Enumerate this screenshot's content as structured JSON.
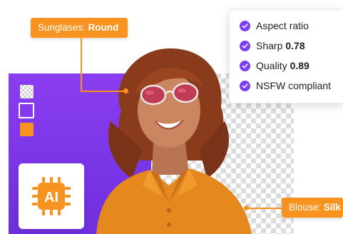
{
  "labels": {
    "sunglasses": {
      "key": "Sunglases:",
      "value": "Round"
    },
    "blouse": {
      "key": "Blouse:",
      "value": "Silk"
    }
  },
  "checklist": [
    {
      "label": "Aspect ratio",
      "value": ""
    },
    {
      "label": "Sharp",
      "value": "0.78"
    },
    {
      "label": "Quality",
      "value": "0.89"
    },
    {
      "label": "NSFW compliant",
      "value": ""
    }
  ],
  "badge": {
    "text": "AI"
  },
  "colors": {
    "accent_orange": "#f7931e",
    "accent_purple": "#7b3ff2",
    "panel_purple": "#8a3df0"
  },
  "icons": {
    "check": "check-circle-icon",
    "chip": "ai-chip-icon"
  }
}
